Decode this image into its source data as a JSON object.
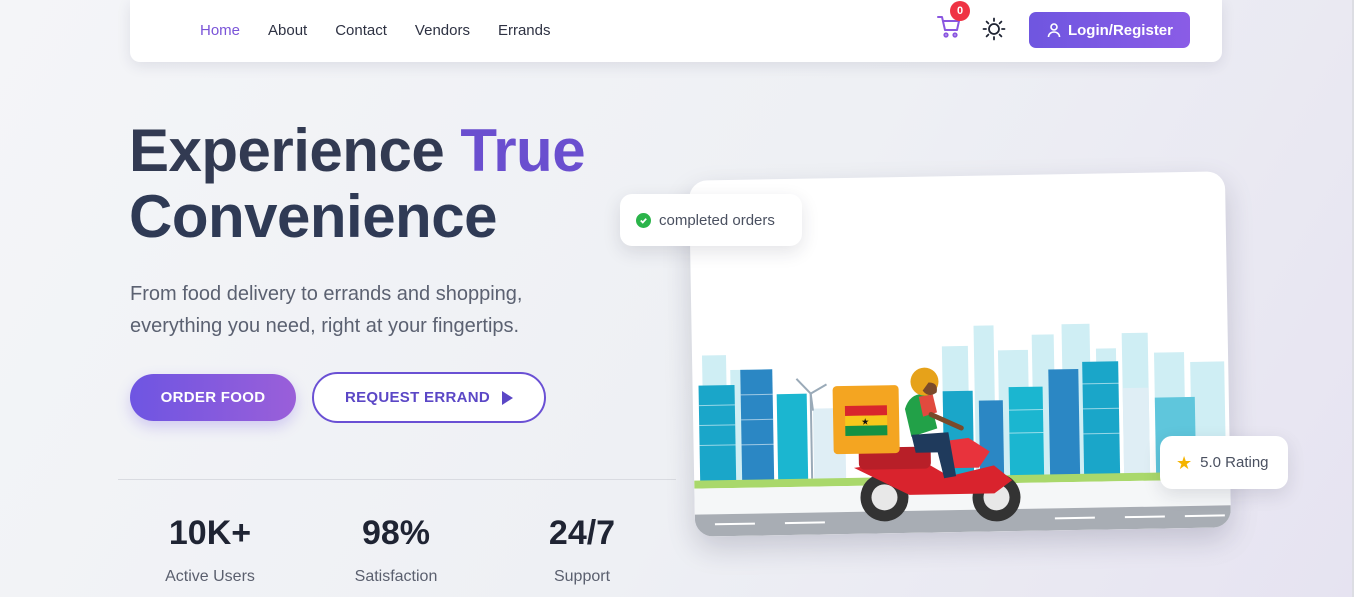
{
  "nav": {
    "links": [
      "Home",
      "About",
      "Contact",
      "Vendors",
      "Errands"
    ],
    "cart_count": "0",
    "cart_icon": "cart-icon",
    "theme_icon": "sun-icon",
    "login_label": "Login/Register",
    "accent_color": "#7a54d8"
  },
  "hero": {
    "title_part1": "Experience ",
    "title_accent": "True",
    "title_line2": "Convenience",
    "subtitle_line1": "From food delivery to errands and shopping,",
    "subtitle_line2": "everything you need, right at your fingertips.",
    "order_button": "ORDER FOOD",
    "errand_button": "REQUEST ERRAND"
  },
  "stats": [
    {
      "value": "10K+",
      "label": "Active Users"
    },
    {
      "value": "98%",
      "label": "Satisfaction"
    },
    {
      "value": "24/7",
      "label": "Support"
    }
  ],
  "badges": {
    "orders": "completed orders",
    "rating": "5.0 Rating"
  },
  "colors": {
    "primary": "#6e55e2",
    "badge_red": "#ef3344",
    "success": "#2bb44a",
    "star": "#f5b400"
  }
}
